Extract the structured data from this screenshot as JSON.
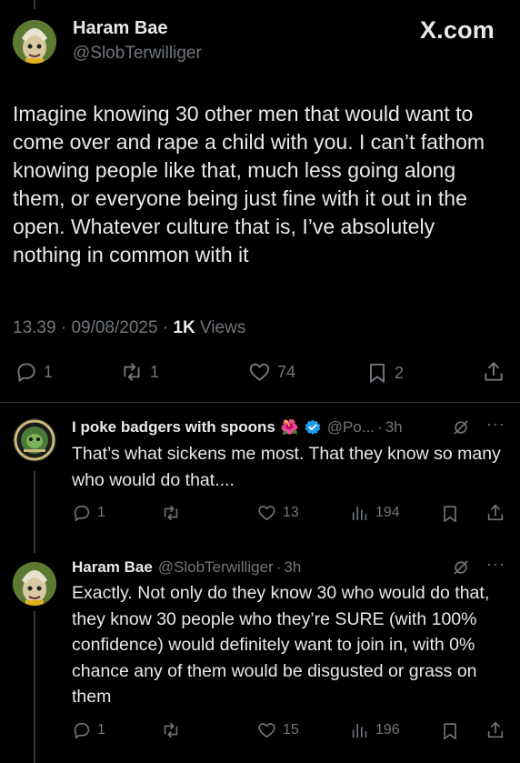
{
  "watermark": "X.com",
  "main_tweet": {
    "author_name": "Haram Bae",
    "author_handle": "@SlobTerwilliger",
    "text": "Imagine knowing 30 other men that would want to come over and rape a child with you. I can’t fathom knowing people like that, much less going along them, or everyone being just fine with it out in the open. Whatever culture that is, I’ve absolutely nothing in common with it",
    "time": "13.39",
    "date": "09/08/2025",
    "views_count": "1K",
    "views_label": "Views",
    "replies": "1",
    "reposts": "1",
    "likes": "74",
    "bookmarks": "2"
  },
  "replies": [
    {
      "author_name": "I poke badgers with spoons",
      "emoji": "🌺",
      "verified": true,
      "author_handle": "@Po...",
      "separator": "·",
      "time": "3h",
      "text": "That’s what sickens me most. That they know so many who would do that....",
      "replies": "1",
      "reposts": "",
      "likes": "13",
      "views": "194"
    },
    {
      "author_name": "Haram Bae",
      "author_handle": "@SlobTerwilliger",
      "separator": "·",
      "time": "3h",
      "text": "Exactly. Not only do they know 30 who would do that, they know 30 people who they’re SURE (with 100% confidence) would definitely want to join in, with 0% chance any of them would be disgusted or grass on them",
      "replies": "1",
      "reposts": "",
      "likes": "15",
      "views": "196"
    }
  ],
  "icons": {
    "reply": "reply-icon",
    "repost": "repost-icon",
    "like": "heart-icon",
    "bookmark": "bookmark-icon",
    "share": "share-icon",
    "views": "views-icon",
    "grok": "grok-icon",
    "more": "more-icon",
    "verified": "verified-badge-icon"
  },
  "colors": {
    "background": "#000000",
    "text": "#e7e9ea",
    "muted": "#71767b",
    "verified": "#1d9bf0"
  }
}
